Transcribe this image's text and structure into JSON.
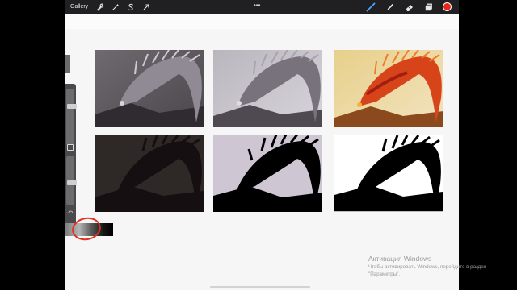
{
  "toolbar": {
    "gallery_label": "Gallery",
    "left_icons": [
      "wrench-icon",
      "magic-wand-icon",
      "selection-s-icon",
      "transform-arrow-icon"
    ],
    "more_label": "•••",
    "right_icons": [
      "brush-icon",
      "smudge-icon",
      "eraser-icon",
      "layers-icon"
    ],
    "active_color": "#e8261a"
  },
  "canvas": {
    "thumbnails": [
      {
        "label": "grey-toned dragon artwork",
        "palette": "grey"
      },
      {
        "label": "light grey dragon artwork",
        "palette": "light"
      },
      {
        "label": "orange fire dragon artwork",
        "palette": "orange"
      },
      {
        "label": "dark brown silhouette",
        "palette": "dark"
      },
      {
        "label": "black silhouette on lavender",
        "palette": "lavender"
      },
      {
        "label": "black silhouette on white",
        "palette": "white"
      }
    ]
  },
  "sidebar": {
    "size_slider_value": 0.7,
    "opacity_slider_value": 0.45
  },
  "colors": {
    "app_background": "#f6f6f6",
    "toolbar": "#202022",
    "highlight_circle": "#e0301e"
  },
  "watermark": {
    "title": "Активация Windows",
    "line1": "Чтобы активировать Windows, перейдите в раздел",
    "line2": "\"Параметры\"."
  }
}
